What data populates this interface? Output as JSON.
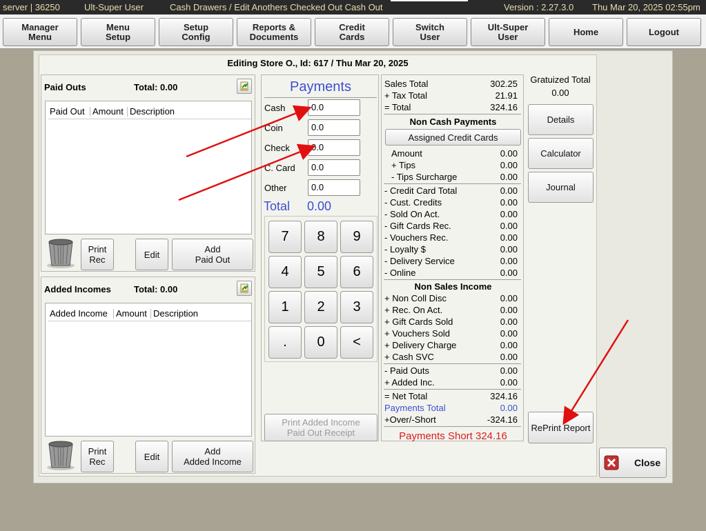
{
  "topbar": {
    "server": "server | 36250",
    "user": "Ult-Super User",
    "path": "Cash Drawers / Edit Anothers Checked Out Cash Out",
    "version": "Version : 2.27.3.0",
    "datetime": "Thu Mar 20, 2025  02:55pm"
  },
  "nav": [
    "Manager\nMenu",
    "Menu\nSetup",
    "Setup\nConfig",
    "Reports &\nDocuments",
    "Credit\nCards",
    "Switch\nUser",
    "Ult-Super\nUser",
    "Home",
    "Logout"
  ],
  "dialog_title": "Editing Store O., Id: 617 / Thu Mar 20, 2025",
  "paid_outs": {
    "title": "Paid Outs",
    "total": "Total: 0.00",
    "col1": "Paid Out",
    "col2": "Amount",
    "col3": "Description",
    "print": "Print\nRec",
    "edit": "Edit",
    "add": "Add\nPaid Out"
  },
  "added_incomes": {
    "title": "Added Incomes",
    "total": "Total: 0.00",
    "col1": "Added Income",
    "col2": "Amount",
    "col3": "Description",
    "print": "Print\nRec",
    "edit": "Edit",
    "add": "Add\nAdded Income"
  },
  "payments": {
    "title": "Payments",
    "labels": [
      "Cash",
      "Coin",
      "Check",
      "C. Card",
      "Other"
    ],
    "values": [
      "0.0",
      "0.0",
      "0.0",
      "0.0",
      "0.0"
    ],
    "total_label": "Total",
    "total_value": "0.00",
    "print_receipt": "Print Added Income\nPaid Out Receipt"
  },
  "keypad": [
    "7",
    "8",
    "9",
    "4",
    "5",
    "6",
    "1",
    "2",
    "3",
    ".",
    "0",
    "<"
  ],
  "summary": {
    "sales_total": [
      "Sales Total",
      "302.25"
    ],
    "tax_total": [
      "+ Tax Total",
      "21.91"
    ],
    "total": [
      "= Total",
      "324.16"
    ],
    "non_cash_header": "Non Cash Payments",
    "assigned_cc": "Assigned Credit Cards",
    "cc_rows": [
      [
        "Amount",
        "0.00"
      ],
      [
        "+ Tips",
        "0.00"
      ],
      [
        "- Tips Surcharge",
        "0.00"
      ]
    ],
    "deduct_rows": [
      [
        "- Credit Card Total",
        "0.00"
      ],
      [
        "- Cust. Credits",
        "0.00"
      ],
      [
        "- Sold On Act.",
        "0.00"
      ],
      [
        "- Gift Cards Rec.",
        "0.00"
      ],
      [
        "- Vouchers Rec.",
        "0.00"
      ],
      [
        "- Loyalty $",
        "0.00"
      ],
      [
        "- Delivery Service",
        "0.00"
      ],
      [
        "- Online",
        "0.00"
      ]
    ],
    "non_sales_header": "Non Sales Income",
    "income_rows": [
      [
        "+ Non Coll Disc",
        "0.00"
      ],
      [
        "+ Rec. On Act.",
        "0.00"
      ],
      [
        "+ Gift Cards Sold",
        "0.00"
      ],
      [
        "+ Vouchers Sold",
        "0.00"
      ],
      [
        "+ Delivery Charge",
        "0.00"
      ],
      [
        "+ Cash SVC",
        "0.00"
      ]
    ],
    "paid_rows": [
      [
        "- Paid Outs",
        "0.00"
      ],
      [
        "+ Added Inc.",
        "0.00"
      ]
    ],
    "net_total": [
      "= Net Total",
      "324.16"
    ],
    "payments_total": [
      "Payments Total",
      "0.00"
    ],
    "over_short": [
      "+Over/-Short",
      "-324.16"
    ],
    "status": "Payments Short 324.16"
  },
  "right": {
    "grat_label": "Gratuized Total",
    "grat_value": "0.00",
    "details": "Details",
    "calculator": "Calculator",
    "journal": "Journal",
    "reprint": "RePrint Report",
    "close": "Close"
  },
  "colors": {
    "accent_blue": "#3a4fd0",
    "short_red": "#d81e1e",
    "annotation_red": "#e01010"
  }
}
